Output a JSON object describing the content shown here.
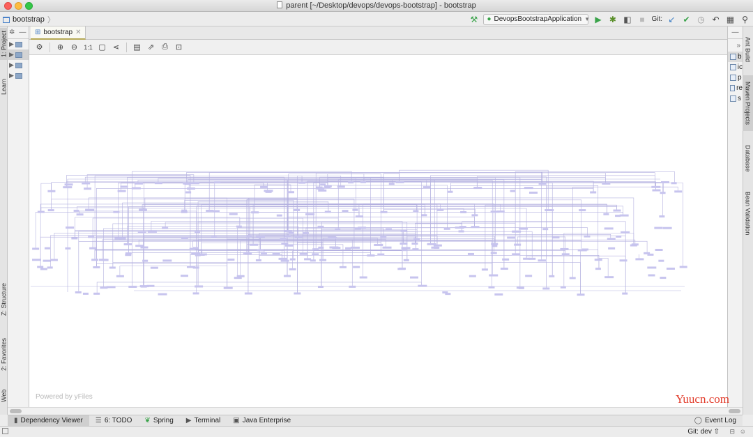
{
  "window": {
    "title": "parent [~/Desktop/devops/devops-bootstrap] - bootstrap"
  },
  "navbar": {
    "breadcrumb": "bootstrap",
    "run_config": "DevopsBootstrapApplication",
    "git_label": "Git:"
  },
  "left_tabs": [
    "1: Project",
    "Learn",
    "Z: Structure",
    "2: Favorites",
    "Web"
  ],
  "right_tabs": [
    "Ant Build",
    "Maven Projects",
    "Database",
    "Bean Validation"
  ],
  "editor": {
    "tab_label": "bootstrap",
    "zoom_actual_label": "1:1",
    "powered_by": "Powered by yFiles"
  },
  "right_panel": {
    "items": [
      "b",
      "ic",
      "p",
      "re",
      "s"
    ]
  },
  "bottom_tabs": [
    {
      "label": "Dependency Viewer",
      "icon": "dependency-icon"
    },
    {
      "label": "6: TODO",
      "icon": "todo-list-icon"
    },
    {
      "label": "Spring",
      "icon": "spring-leaf-icon"
    },
    {
      "label": "Terminal",
      "icon": "terminal-icon"
    },
    {
      "label": "Java Enterprise",
      "icon": "java-enterprise-icon"
    }
  ],
  "event_log": "Event Log",
  "status": {
    "git_branch": "Git: dev ⇧"
  },
  "watermark": "Yuucn.com",
  "colors": {
    "graph_node": "#c7c4ee",
    "graph_edge": "#b4b1e0",
    "tab_underline": "#b6a955",
    "run_green": "#3aa34a",
    "debug_green": "#5a8f2a"
  }
}
